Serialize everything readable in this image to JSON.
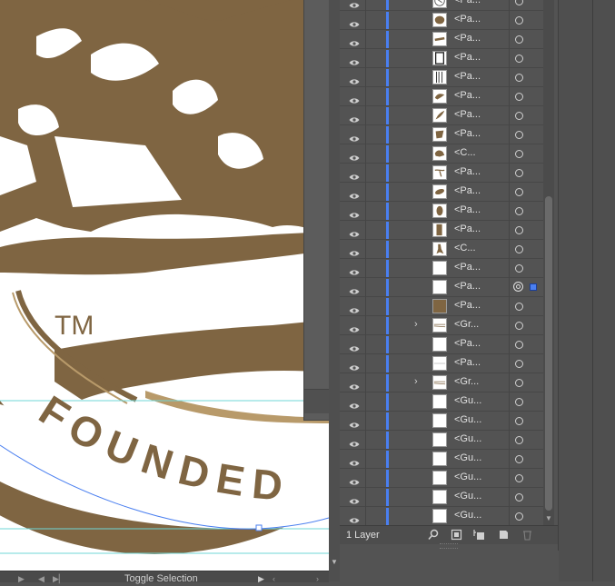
{
  "canvas": {
    "artwork": {
      "tm_text": "TM",
      "founded_text": "FOUNDED",
      "brand_color": "#7f6542"
    }
  },
  "statusbar": {
    "label": "Toggle Selection"
  },
  "layers_panel": {
    "layer_count_label": "1 Layer",
    "rows": [
      {
        "name": "<Pa...",
        "thumb": "logo"
      },
      {
        "name": "<Pa...",
        "thumb": "blob"
      },
      {
        "name": "<Pa...",
        "thumb": "stroke"
      },
      {
        "name": "<Pa...",
        "thumb": "frame"
      },
      {
        "name": "<Pa...",
        "thumb": "frame2"
      },
      {
        "name": "<Pa...",
        "thumb": "bird"
      },
      {
        "name": "<Pa...",
        "thumb": "feather"
      },
      {
        "name": "<Pa...",
        "thumb": "shape"
      },
      {
        "name": "<C...",
        "thumb": "creature"
      },
      {
        "name": "<Pa...",
        "thumb": "branch"
      },
      {
        "name": "<Pa...",
        "thumb": "leaf"
      },
      {
        "name": "<Pa...",
        "thumb": "oval"
      },
      {
        "name": "<Pa...",
        "thumb": "bar"
      },
      {
        "name": "<C...",
        "thumb": "figure"
      },
      {
        "name": "<Pa...",
        "thumb": "blank"
      },
      {
        "name": "<Pa...",
        "thumb": "blank",
        "selected": true
      },
      {
        "name": "<Pa...",
        "thumb": "brown"
      },
      {
        "name": "<Gr...",
        "thumb": "lines",
        "group": true
      },
      {
        "name": "<Pa...",
        "thumb": "blank"
      },
      {
        "name": "<Pa...",
        "thumb": "thinline"
      },
      {
        "name": "<Gr...",
        "thumb": "lines",
        "group": true
      },
      {
        "name": "<Gu...",
        "thumb": "blank"
      },
      {
        "name": "<Gu...",
        "thumb": "blank"
      },
      {
        "name": "<Gu...",
        "thumb": "blank"
      },
      {
        "name": "<Gu...",
        "thumb": "blank"
      },
      {
        "name": "<Gu...",
        "thumb": "blank"
      },
      {
        "name": "<Gu...",
        "thumb": "blank"
      },
      {
        "name": "<Gu...",
        "thumb": "blank"
      }
    ]
  },
  "colors": {
    "selection_blue": "#4a7ff0",
    "guide_cyan": "#6fd7d7",
    "panel_bg": "#535353"
  }
}
